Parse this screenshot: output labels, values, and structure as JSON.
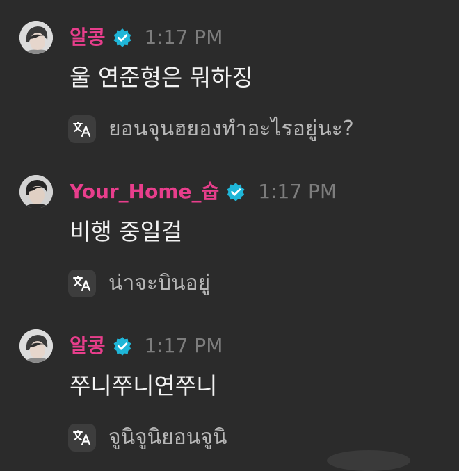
{
  "colors": {
    "background": "#2b2b2b",
    "username_pink": "#e83e8c",
    "verified_cyan": "#1fb6d8",
    "timestamp_gray": "#7d7d7d",
    "translation_gray": "#b7b7b7"
  },
  "messages": [
    {
      "username": "알콩",
      "timestamp": "1:17 PM",
      "text": "울 연준형은 뭐하징",
      "translation": "ยอนจุนฮยองทำอะไรอยู่นะ?",
      "verified_icon": "verified-check-icon",
      "translate_icon": "translate-icon"
    },
    {
      "username": "Your_Home_숩",
      "timestamp": "1:17 PM",
      "text": "비행 중일걸",
      "translation": "น่าจะบินอยู่",
      "verified_icon": "verified-check-icon",
      "translate_icon": "translate-icon"
    },
    {
      "username": "알콩",
      "timestamp": "1:17 PM",
      "text": "쭈니쭈니연쭈니",
      "translation": "จูนิจูนิยอนจูนิ",
      "verified_icon": "verified-check-icon",
      "translate_icon": "translate-icon"
    }
  ]
}
